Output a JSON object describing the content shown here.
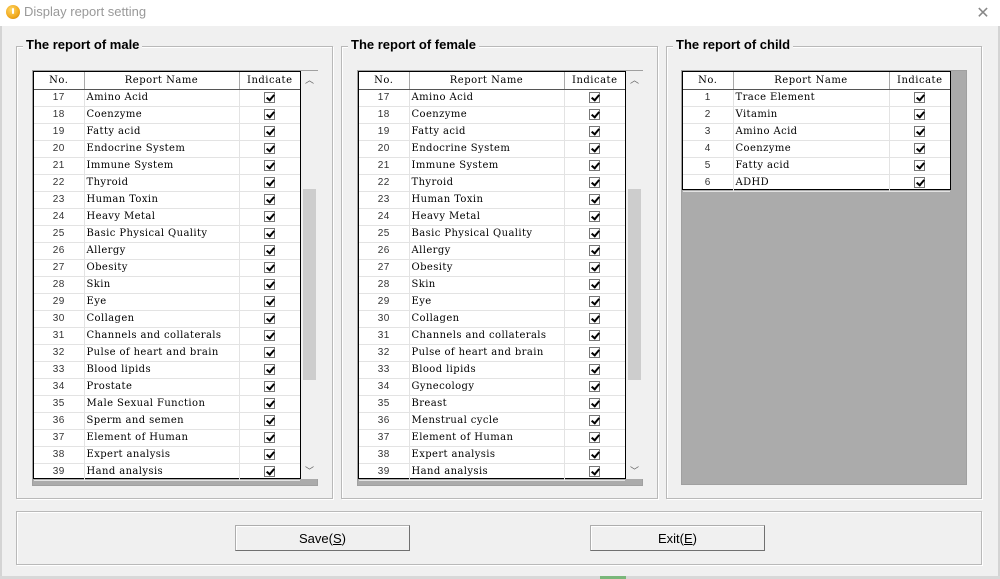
{
  "window": {
    "title": "Display report setting",
    "app_icon": "warning-app-icon",
    "close_icon": "close-icon"
  },
  "columns": {
    "no": "No.",
    "name": "Report Name",
    "indicate": "Indicate"
  },
  "male": {
    "title": "The report of male",
    "scroll_position": 0.55,
    "rows": [
      {
        "no": "17",
        "name": "Amino Acid",
        "checked": true
      },
      {
        "no": "18",
        "name": "Coenzyme",
        "checked": true
      },
      {
        "no": "19",
        "name": "Fatty acid",
        "checked": true
      },
      {
        "no": "20",
        "name": "Endocrine System",
        "checked": true
      },
      {
        "no": "21",
        "name": "Immune System",
        "checked": true
      },
      {
        "no": "22",
        "name": "Thyroid",
        "checked": true
      },
      {
        "no": "23",
        "name": "Human Toxin",
        "checked": true
      },
      {
        "no": "24",
        "name": "Heavy Metal",
        "checked": true
      },
      {
        "no": "25",
        "name": "Basic Physical Quality",
        "checked": true
      },
      {
        "no": "26",
        "name": "Allergy",
        "checked": true
      },
      {
        "no": "27",
        "name": "Obesity",
        "checked": true
      },
      {
        "no": "28",
        "name": "Skin",
        "checked": true
      },
      {
        "no": "29",
        "name": "Eye",
        "checked": true
      },
      {
        "no": "30",
        "name": "Collagen",
        "checked": true
      },
      {
        "no": "31",
        "name": "Channels and collaterals",
        "checked": true
      },
      {
        "no": "32",
        "name": "Pulse of heart and brain",
        "checked": true
      },
      {
        "no": "33",
        "name": "Blood lipids",
        "checked": true
      },
      {
        "no": "34",
        "name": "Prostate",
        "checked": true
      },
      {
        "no": "35",
        "name": "Male Sexual Function",
        "checked": true
      },
      {
        "no": "36",
        "name": "Sperm and semen",
        "checked": true
      },
      {
        "no": "37",
        "name": "Element of Human",
        "checked": true
      },
      {
        "no": "38",
        "name": "Expert analysis",
        "checked": true
      },
      {
        "no": "39",
        "name": "Hand analysis",
        "checked": true
      }
    ]
  },
  "female": {
    "title": "The report of female",
    "scroll_position": 0.55,
    "rows": [
      {
        "no": "17",
        "name": "Amino Acid",
        "checked": true
      },
      {
        "no": "18",
        "name": "Coenzyme",
        "checked": true
      },
      {
        "no": "19",
        "name": "Fatty acid",
        "checked": true
      },
      {
        "no": "20",
        "name": "Endocrine System",
        "checked": true
      },
      {
        "no": "21",
        "name": "Immune System",
        "checked": true
      },
      {
        "no": "22",
        "name": "Thyroid",
        "checked": true
      },
      {
        "no": "23",
        "name": "Human Toxin",
        "checked": true
      },
      {
        "no": "24",
        "name": "Heavy Metal",
        "checked": true
      },
      {
        "no": "25",
        "name": "Basic Physical Quality",
        "checked": true
      },
      {
        "no": "26",
        "name": "Allergy",
        "checked": true
      },
      {
        "no": "27",
        "name": "Obesity",
        "checked": true
      },
      {
        "no": "28",
        "name": "Skin",
        "checked": true
      },
      {
        "no": "29",
        "name": "Eye",
        "checked": true
      },
      {
        "no": "30",
        "name": "Collagen",
        "checked": true
      },
      {
        "no": "31",
        "name": "Channels and collaterals",
        "checked": true
      },
      {
        "no": "32",
        "name": "Pulse of heart and brain",
        "checked": true
      },
      {
        "no": "33",
        "name": "Blood lipids",
        "checked": true
      },
      {
        "no": "34",
        "name": "Gynecology",
        "checked": true
      },
      {
        "no": "35",
        "name": "Breast",
        "checked": true
      },
      {
        "no": "36",
        "name": "Menstrual cycle",
        "checked": true
      },
      {
        "no": "37",
        "name": "Element of Human",
        "checked": true
      },
      {
        "no": "38",
        "name": "Expert analysis",
        "checked": true
      },
      {
        "no": "39",
        "name": "Hand analysis",
        "checked": true
      }
    ]
  },
  "child": {
    "title": "The report of child",
    "rows": [
      {
        "no": "1",
        "name": "Trace Element",
        "checked": true
      },
      {
        "no": "2",
        "name": "Vitamin",
        "checked": true
      },
      {
        "no": "3",
        "name": "Amino Acid",
        "checked": true
      },
      {
        "no": "4",
        "name": "Coenzyme",
        "checked": true
      },
      {
        "no": "5",
        "name": "Fatty acid",
        "checked": true
      },
      {
        "no": "6",
        "name": "ADHD",
        "checked": true
      }
    ]
  },
  "buttons": {
    "save": {
      "label": "Save(",
      "mnemonic": "S",
      "suffix": ")"
    },
    "exit": {
      "label": "Exit(",
      "mnemonic": "E",
      "suffix": ")"
    }
  },
  "scroll_icons": {
    "up": "chevron-up-icon",
    "down": "chevron-down-icon"
  }
}
